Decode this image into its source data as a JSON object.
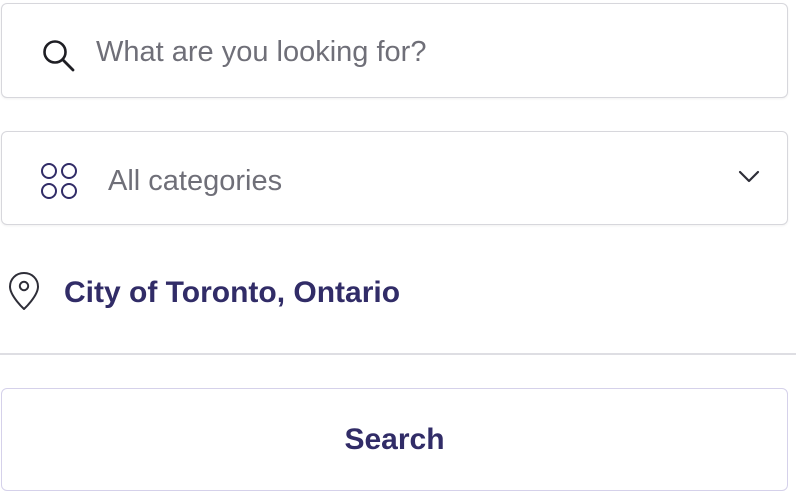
{
  "search": {
    "placeholder": "What are you looking for?",
    "value": "",
    "icon": "search-icon"
  },
  "category": {
    "selected": "All categories",
    "icon": "categories-icon",
    "dropdown_icon": "chevron-down-icon"
  },
  "location": {
    "text": "City of Toronto, Ontario",
    "icon": "map-pin-icon"
  },
  "search_button": {
    "label": "Search"
  },
  "colors": {
    "accent": "#312c67",
    "border": "#d7d7dc",
    "placeholder": "#6f6f78",
    "divider": "#dedee3"
  }
}
